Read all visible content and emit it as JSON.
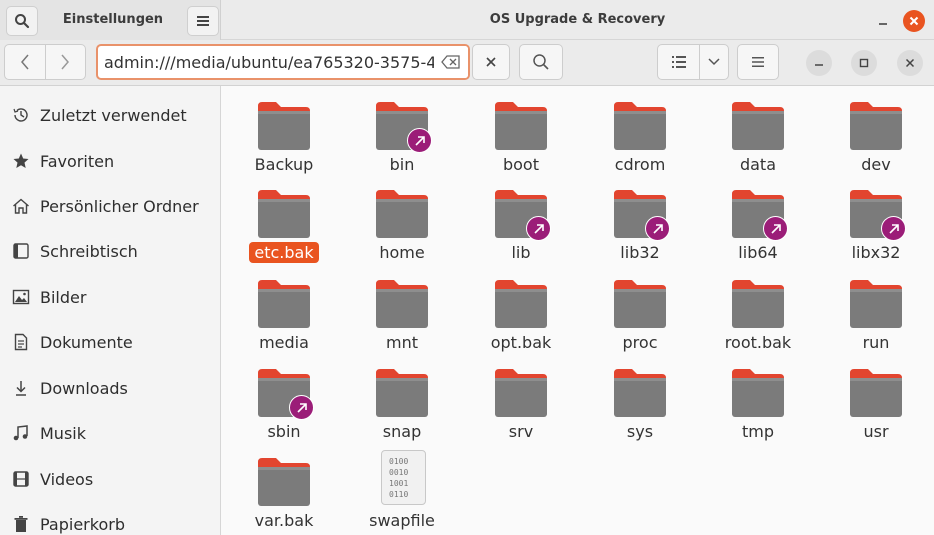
{
  "titlebar": {
    "left_title": "Einstellungen",
    "title": "OS Upgrade & Recovery"
  },
  "toolbar": {
    "path": "admin:///media/ubuntu/ea765320-3575-4"
  },
  "sidebar": {
    "items": [
      {
        "label": "Zuletzt verwendet",
        "icon": "clock-icon"
      },
      {
        "label": "Favoriten",
        "icon": "star-icon"
      },
      {
        "label": "Persönlicher Ordner",
        "icon": "home-icon"
      },
      {
        "label": "Schreibtisch",
        "icon": "desktop-icon"
      },
      {
        "label": "Bilder",
        "icon": "image-icon"
      },
      {
        "label": "Dokumente",
        "icon": "document-icon"
      },
      {
        "label": "Downloads",
        "icon": "download-icon"
      },
      {
        "label": "Musik",
        "icon": "music-icon"
      },
      {
        "label": "Videos",
        "icon": "video-icon"
      },
      {
        "label": "Papierkorb",
        "icon": "trash-icon"
      }
    ]
  },
  "files": [
    {
      "name": "Backup"
    },
    {
      "name": "bin"
    },
    {
      "name": "boot"
    },
    {
      "name": "cdrom"
    },
    {
      "name": "data"
    },
    {
      "name": "dev"
    },
    {
      "name": "etc.bak"
    },
    {
      "name": "home"
    },
    {
      "name": "lib"
    },
    {
      "name": "lib32"
    },
    {
      "name": "lib64"
    },
    {
      "name": "libx32"
    },
    {
      "name": "media"
    },
    {
      "name": "mnt"
    },
    {
      "name": "opt.bak"
    },
    {
      "name": "proc"
    },
    {
      "name": "root.bak"
    },
    {
      "name": "run"
    },
    {
      "name": "sbin"
    },
    {
      "name": "snap"
    },
    {
      "name": "srv"
    },
    {
      "name": "sys"
    },
    {
      "name": "tmp"
    },
    {
      "name": "usr"
    },
    {
      "name": "var.bak"
    },
    {
      "name": "swapfile"
    }
  ],
  "binary_preview": [
    "0100",
    "0010",
    "1001",
    "0110"
  ],
  "colors": {
    "accent": "#e95420",
    "folder_tab": "#e2452f",
    "folder_body": "#7b7b7b",
    "link_badge": "#9b1d78"
  }
}
